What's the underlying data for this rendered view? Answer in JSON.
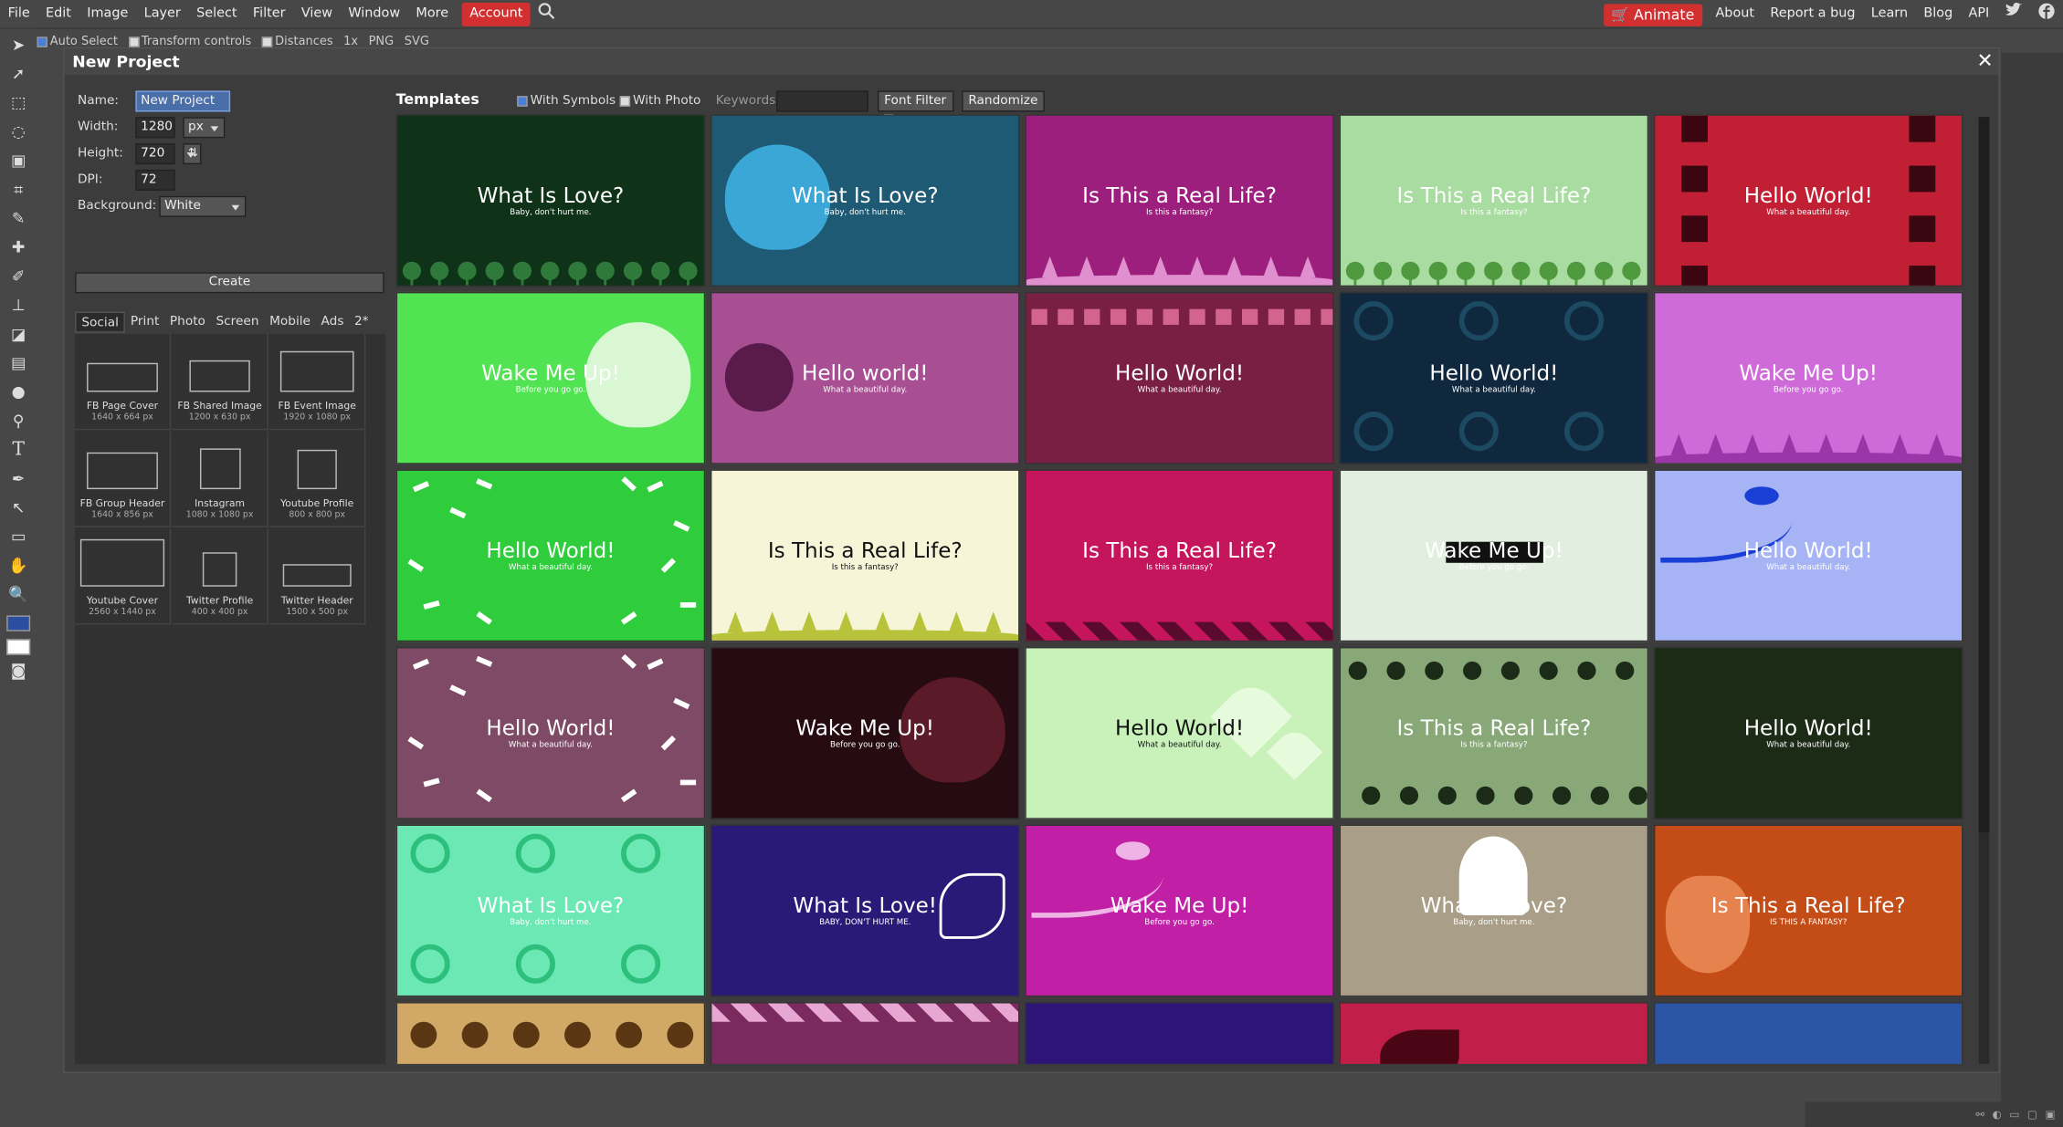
{
  "menubar": {
    "items": [
      "File",
      "Edit",
      "Image",
      "Layer",
      "Select",
      "Filter",
      "View",
      "Window",
      "More"
    ],
    "account_label": "Account",
    "search_icon": "search-icon",
    "animate_label": "Animate",
    "right_links": [
      "About",
      "Report a bug",
      "Learn",
      "Blog",
      "API"
    ],
    "social_icons": [
      "twitter-icon",
      "facebook-icon"
    ]
  },
  "optbar": {
    "auto_select": "Auto Select",
    "transform_controls": "Transform controls",
    "distances": "Distances",
    "zoom": "1x",
    "png": "PNG",
    "svg": "SVG"
  },
  "toolbar": {
    "icons": [
      "move-icon",
      "select-icon",
      "marquee-icon",
      "lasso-icon",
      "quick-select-icon",
      "crop-icon",
      "eyedropper-icon",
      "heal-icon",
      "brush-icon",
      "clone-stamp-icon",
      "eraser-icon",
      "gradient-icon",
      "blur-icon",
      "dodge-icon",
      "text-icon",
      "pen-icon",
      "path-select-icon",
      "shape-icon",
      "hand-icon",
      "zoom-icon"
    ],
    "fg_color": "#2b4ea0",
    "bg_color": "#ffffff"
  },
  "modal": {
    "title": "New Project",
    "close": "✕",
    "form": {
      "name_label": "Name:",
      "name_value": "New Project",
      "width_label": "Width:",
      "width_value": "1280",
      "unit": "px",
      "height_label": "Height:",
      "height_value": "720",
      "dpi_label": "DPI:",
      "dpi_value": "72",
      "background_label": "Background:",
      "background_value": "White",
      "create_label": "Create"
    },
    "category_tabs": [
      "Social",
      "Print",
      "Photo",
      "Screen",
      "Mobile",
      "Ads",
      "2*"
    ],
    "presets": [
      {
        "name": "FB Page Cover",
        "size": "1640 x 664 px"
      },
      {
        "name": "FB Shared Image",
        "size": "1200 x 630 px"
      },
      {
        "name": "FB Event Image",
        "size": "1920 x 1080 px"
      },
      {
        "name": "FB Group Header",
        "size": "1640 x 856 px"
      },
      {
        "name": "Instagram",
        "size": "1080 x 1080 px"
      },
      {
        "name": "Youtube Profile",
        "size": "800 x 800 px"
      },
      {
        "name": "Youtube Cover",
        "size": "2560 x 1440 px"
      },
      {
        "name": "Twitter Profile",
        "size": "400 x 400 px"
      },
      {
        "name": "Twitter Header",
        "size": "1500 x 500 px"
      }
    ],
    "templates_header": {
      "title": "Templates",
      "with_symbols": "With Symbols",
      "with_photo": "With Photo",
      "keywords_label": "Keywords:",
      "keywords_value": "",
      "font_filter": "Font Filter",
      "randomize": "Randomize"
    },
    "templates": [
      {
        "bg": "#0f3318",
        "fg": "#ffffff",
        "title": "What Is Love?",
        "sub": "Baby, don't hurt me.",
        "deco": "flowers-bottom",
        "decoColor": "#2f7a3a"
      },
      {
        "bg": "#1f5a75",
        "fg": "#ffffff",
        "title": "What Is Love?",
        "sub": "Baby, don't hurt me.",
        "deco": "tulip-left",
        "decoColor": "#3aa7d6"
      },
      {
        "bg": "#9d1f7d",
        "fg": "#ffffff",
        "title": "Is This a Real Life?",
        "sub": "Is this a fantasy?",
        "deco": "trees-bottom",
        "decoColor": "#e08fcf"
      },
      {
        "bg": "#a9dca0",
        "fg": "#ffffff",
        "title": "Is This a Real Life?",
        "sub": "Is this a fantasy?",
        "deco": "flowers-bottom",
        "decoColor": "#4f9a3f"
      },
      {
        "bg": "#c11f34",
        "fg": "#ffffff",
        "title": "Hello World!",
        "sub": "What a beautiful day.",
        "deco": "film",
        "decoColor": "#3a0710"
      },
      {
        "bg": "#52e353",
        "fg": "#ffffff",
        "title": "Wake Me Up!",
        "sub": "Before you go go.",
        "deco": "tulip-right",
        "decoColor": "#d8f7d2"
      },
      {
        "bg": "#a84f93",
        "fg": "#ffffff",
        "title": "Hello world!",
        "sub": "What a beautiful day.",
        "deco": "flower-left",
        "decoColor": "#5a1a4a"
      },
      {
        "bg": "#7a1f44",
        "fg": "#ffffff",
        "title": "Hello World!",
        "sub": "What a beautiful day.",
        "deco": "squares-top",
        "decoColor": "#d2648d"
      },
      {
        "bg": "#10283d",
        "fg": "#ffffff",
        "title": "Hello World!",
        "sub": "What a beautiful day.",
        "deco": "swirls",
        "decoColor": "#1d4a63"
      },
      {
        "bg": "#cf6bd8",
        "fg": "#ffffff",
        "title": "Wake Me Up!",
        "sub": "Before you go go.",
        "deco": "trees-bottom",
        "decoColor": "#9a36a8"
      },
      {
        "bg": "#2fcd3c",
        "fg": "#ffffff",
        "title": "Hello World!",
        "sub": "What a beautiful day.",
        "deco": "confetti",
        "decoColor": "#ffffff"
      },
      {
        "bg": "#f7f5d8",
        "fg": "#111111",
        "title": "Is This a Real Life?",
        "sub": "Is this a fantasy?",
        "deco": "trees-bottom",
        "decoColor": "#b8c23a"
      },
      {
        "bg": "#c5155c",
        "fg": "#ffffff",
        "title": "Is This a Real Life?",
        "sub": "Is this a fantasy?",
        "deco": "stripes-bottom",
        "decoColor": "#5a0a2c"
      },
      {
        "bg": "#e2efe0",
        "fg": "#ffffff",
        "title": "Wake Me Up!",
        "sub": "Before you go go.",
        "deco": "blackbox",
        "decoColor": "#111111"
      },
      {
        "bg": "#a6b4f5",
        "fg": "#ffffff",
        "title": "Hello World!",
        "sub": "What a beautiful day.",
        "deco": "bird-branch",
        "decoColor": "#1a3fd6"
      },
      {
        "bg": "#7e4a65",
        "fg": "#ffffff",
        "title": "Hello World!",
        "sub": "What a beautiful day.",
        "deco": "confetti",
        "decoColor": "#ffffff"
      },
      {
        "bg": "#260c12",
        "fg": "#ffffff",
        "title": "Wake Me Up!",
        "sub": "Before you go go.",
        "deco": "tulip-right",
        "decoColor": "#5a1a28"
      },
      {
        "bg": "#c9f2ba",
        "fg": "#111111",
        "title": "Hello World!",
        "sub": "What a beautiful day.",
        "deco": "hearts",
        "decoColor": "#e6fadc"
      },
      {
        "bg": "#88a877",
        "fg": "#ffffff",
        "title": "Is This a Real Life?",
        "sub": "Is this a fantasy?",
        "deco": "dots",
        "decoColor": "#1c2b18"
      },
      {
        "bg": "#1c2b16",
        "fg": "#ffffff",
        "title": "Hello World!",
        "sub": "What a beautiful day.",
        "deco": "none",
        "decoColor": "#ffffff"
      },
      {
        "bg": "#6be8b4",
        "fg": "#ffffff",
        "title": "What Is Love?",
        "sub": "Baby, don't hurt me.",
        "deco": "swirls",
        "decoColor": "#2dc07c"
      },
      {
        "bg": "#2a1a78",
        "fg": "#ffffff",
        "title": "What Is Love!",
        "sub": "BABY, DON'T HURT ME.",
        "deco": "star-flower",
        "decoColor": "#ffffff"
      },
      {
        "bg": "#c11fa5",
        "fg": "#ffffff",
        "title": "Wake Me Up!",
        "sub": "Before you go go.",
        "deco": "bird-branch",
        "decoColor": "#f0b3e6"
      },
      {
        "bg": "#a99e87",
        "fg": "#ffffff",
        "title": "What Is Love?",
        "sub": "Baby, don't hurt me.",
        "deco": "ghost",
        "decoColor": "#ffffff"
      },
      {
        "bg": "#c34c17",
        "fg": "#ffffff",
        "title": "Is This a Real Life?",
        "sub": "IS THIS A FANTASY?",
        "deco": "acorn",
        "decoColor": "#e6824d"
      },
      {
        "bg": "#d1a866",
        "fg": "#ffffff",
        "title": "",
        "sub": "",
        "deco": "ornaments",
        "decoColor": "#5a3612"
      },
      {
        "bg": "#7a2a5f",
        "fg": "#ffffff",
        "title": "",
        "sub": "",
        "deco": "stripes-top",
        "decoColor": "#e8a6d3"
      },
      {
        "bg": "#2f1478",
        "fg": "#ffffff",
        "title": "",
        "sub": "",
        "deco": "none",
        "decoColor": "#ffffff"
      },
      {
        "bg": "#c11f4a",
        "fg": "#ffffff",
        "title": "",
        "sub": "",
        "deco": "leaf",
        "decoColor": "#4a0614"
      },
      {
        "bg": "#2d55a6",
        "fg": "#ffffff",
        "title": "",
        "sub": "",
        "deco": "none",
        "decoColor": "#ffffff"
      }
    ]
  }
}
